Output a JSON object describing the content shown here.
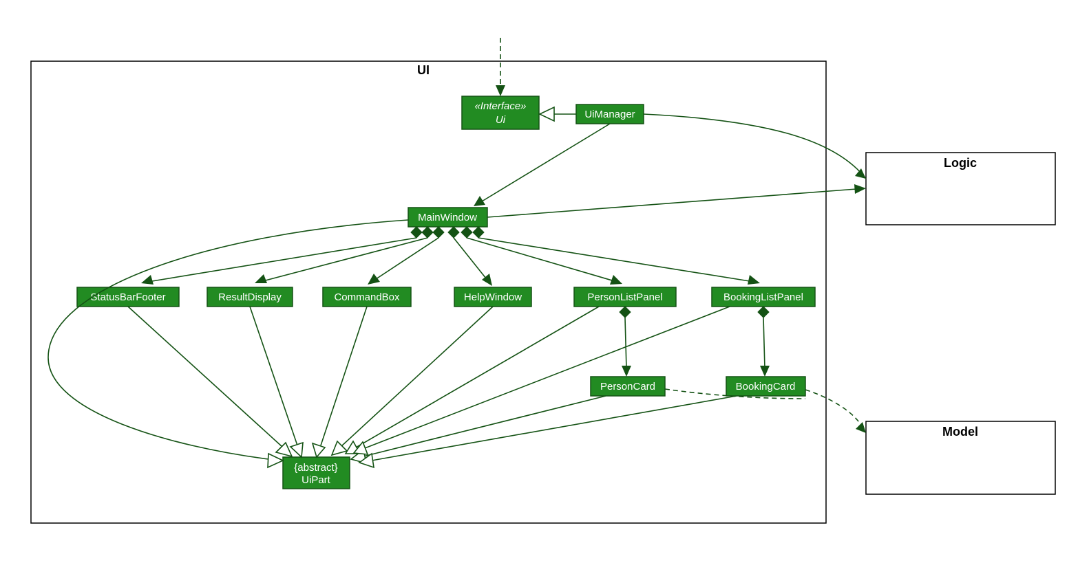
{
  "packages": {
    "ui": "UI",
    "logic": "Logic",
    "model": "Model"
  },
  "nodes": {
    "interface_stereotype": "«Interface»",
    "interface_name": "Ui",
    "uiManager": "UiManager",
    "mainWindow": "MainWindow",
    "statusBarFooter": "StatusBarFooter",
    "resultDisplay": "ResultDisplay",
    "commandBox": "CommandBox",
    "helpWindow": "HelpWindow",
    "personListPanel": "PersonListPanel",
    "bookingListPanel": "BookingListPanel",
    "personCard": "PersonCard",
    "bookingCard": "BookingCard",
    "uiPart_annotation": "{abstract}",
    "uiPart_name": "UiPart"
  }
}
